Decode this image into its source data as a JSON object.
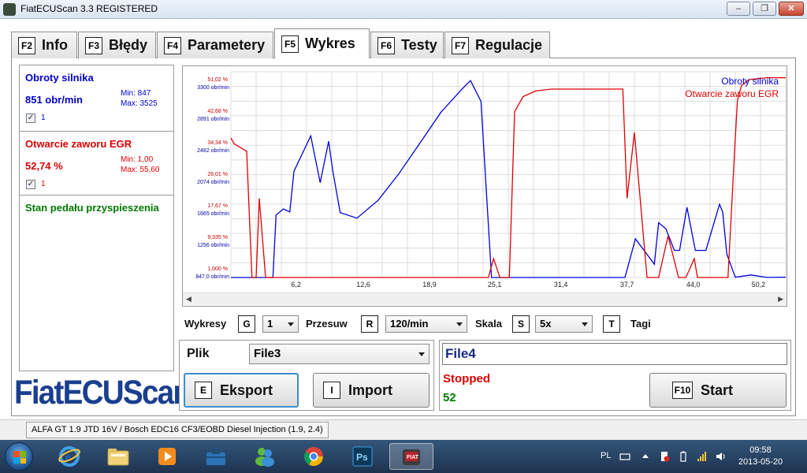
{
  "window": {
    "title": "FiatECUScan 3.3 REGISTERED",
    "minimize": "–",
    "maximize": "❐",
    "close": "✕"
  },
  "tabs": [
    {
      "key": "F2",
      "label": "Info"
    },
    {
      "key": "F3",
      "label": "Błędy"
    },
    {
      "key": "F4",
      "label": "Parametery"
    },
    {
      "key": "F5",
      "label": "Wykres",
      "active": true
    },
    {
      "key": "F6",
      "label": "Testy"
    },
    {
      "key": "F7",
      "label": "Regulacje"
    }
  ],
  "sensors": [
    {
      "name": "Obroty silnika",
      "value": "851 obr/min",
      "min": "Min: 847",
      "max": "Max: 3525",
      "checked": "✓",
      "num": "1",
      "color": "#0000cc"
    },
    {
      "name": "Otwarcie zaworu EGR",
      "value": "52,74 %",
      "min": "Min: 1,00",
      "max": "Max: 55,60",
      "checked": "✓",
      "num": "1",
      "color": "#dd0000"
    },
    {
      "name": "Stan pedału przyspieszenia",
      "color": "#007a00"
    }
  ],
  "logo": "FiatECUScan",
  "chart_data": {
    "type": "line",
    "x_ticks": [
      "6,2",
      "12,6",
      "18,9",
      "25,1",
      "31,4",
      "37,7",
      "44,0",
      "50,2"
    ],
    "y_ticks_red": [
      "51,02 %",
      "42,68 %",
      "34,34 %",
      "26,01 %",
      "17,67 %",
      "9,335 %",
      "1,000 %"
    ],
    "y_ticks_blue": [
      "3300 obr/min",
      "2891 obr/min",
      "2482 obr/min",
      "2074 obr/min",
      "1665 obr/min",
      "1256 obr/min",
      "847,0 obr/min"
    ],
    "legend": [
      "Obroty silnika",
      "Otwarcie zaworu EGR"
    ],
    "legend_placement": "top-right",
    "grid": true,
    "series": [
      {
        "name": "Obroty silnika",
        "color": "#0000dd",
        "axis": "rpm",
        "x": [
          0.0,
          1.5,
          2.0,
          2.4,
          2.7,
          3.3,
          4.0,
          4.3,
          5.0,
          5.6,
          6.0,
          7.6,
          8.5,
          9.3,
          9.7,
          10.4,
          12.0,
          14.0,
          16.0,
          18.0,
          20.0,
          22.0,
          22.8,
          23.8,
          24.8,
          25.4,
          26.5,
          28.0,
          31.0,
          34.5,
          36.5,
          37.0,
          37.5,
          38.5,
          40.3,
          40.7,
          41.4,
          42.2,
          42.7,
          43.4,
          44.2,
          45.2,
          46.5,
          46.8,
          47.2,
          48.0,
          49.5,
          51.0,
          52.8
        ],
        "y": [
          847,
          847,
          847,
          847,
          847,
          847,
          847,
          1660,
          1740,
          1700,
          2230,
          2690,
          2080,
          2620,
          2230,
          1690,
          1620,
          1850,
          2200,
          2600,
          3000,
          3300,
          3410,
          3140,
          847,
          847,
          847,
          847,
          847,
          847,
          847,
          847,
          847,
          1350,
          1020,
          1560,
          1480,
          1200,
          1200,
          1760,
          1200,
          1200,
          1800,
          1700,
          1150,
          850,
          880,
          848,
          851
        ]
      },
      {
        "name": "Otwarcie zaworu EGR",
        "color": "#dd0000",
        "axis": "percent",
        "x": [
          0.0,
          0.3,
          1.5,
          2.0,
          2.4,
          2.7,
          3.3,
          4.0,
          4.3,
          5.0,
          10.0,
          20.0,
          24.5,
          25.0,
          25.6,
          26.5,
          27.0,
          27.8,
          29.0,
          30.5,
          33.0,
          34.5,
          34.8,
          36.5,
          37.3,
          37.7,
          38.4,
          39.6,
          40.1,
          40.7,
          41.6,
          42.6,
          42.8,
          43.3,
          44.1,
          44.4,
          44.9,
          45.4,
          45.8,
          47.3,
          48.0,
          48.2,
          48.6,
          49.3,
          51.0,
          52.8
        ],
        "y": [
          38.0,
          36.5,
          34.5,
          1.0,
          1.0,
          22.0,
          1.0,
          1.0,
          1.0,
          1.0,
          1.0,
          1.0,
          1.0,
          6.0,
          1.0,
          1.0,
          45.0,
          49.0,
          50.5,
          51.0,
          51.0,
          51.0,
          51.0,
          51.0,
          51.0,
          22.0,
          39.5,
          1.0,
          1.0,
          1.0,
          12.0,
          1.0,
          1.0,
          1.0,
          6.0,
          1.0,
          1.0,
          1.0,
          1.0,
          1.0,
          38.0,
          48.0,
          52.0,
          53.5,
          54.0,
          54.0
        ]
      }
    ]
  },
  "controls": {
    "wykresy_label": "Wykresy",
    "wykresy_key": "G",
    "wykresy_value": "1",
    "przesuw_label": "Przesuw",
    "przesuw_key": "R",
    "przesuw_value": "120/min",
    "skala_label": "Skala",
    "skala_key": "S",
    "skala_value": "5x",
    "tagi_key": "T",
    "tagi_label": "Tagi"
  },
  "file_panel": {
    "plik_label": "Plik",
    "plik_value": "File3",
    "eksport_key": "E",
    "eksport_label": "Eksport",
    "import_key": "I",
    "import_label": "Import"
  },
  "record_panel": {
    "file_name": "File4",
    "status": "Stopped",
    "count": "52",
    "start_key": "F10",
    "start_label": "Start"
  },
  "statusbar": {
    "vehicle": "ALFA GT 1.9 JTD 16V / Bosch EDC16 CF3/EOBD Diesel Injection (1.9, 2.4)"
  },
  "taskbar": {
    "lang": "PL",
    "time": "09:58",
    "date": "2013-05-20",
    "apps": [
      "internet-explorer-icon",
      "file-explorer-icon",
      "media-player-icon",
      "briefcase-icon",
      "messenger-icon",
      "chrome-icon",
      "photoshop-icon",
      "fiatecuscan-icon"
    ]
  }
}
